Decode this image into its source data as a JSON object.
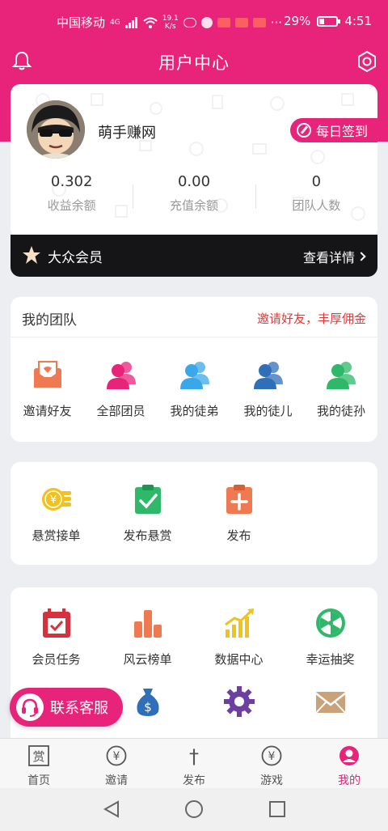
{
  "status_bar": {
    "carrier": "中国移动",
    "network": "4G",
    "speed_value": "19.1",
    "speed_unit": "K/s",
    "battery_percent": "29%",
    "battery_level": 0.29,
    "time": "4:51"
  },
  "header": {
    "title": "用户中心"
  },
  "profile": {
    "username": "萌手赚网",
    "signin_label": "每日签到",
    "stats": [
      {
        "value": "0.302",
        "label": "收益余额"
      },
      {
        "value": "0.00",
        "label": "充值余额"
      },
      {
        "value": "0",
        "label": "团队人数"
      }
    ]
  },
  "membership": {
    "level": "大众会员",
    "detail_label": "查看详情"
  },
  "team": {
    "title": "我的团队",
    "invite_slogan": "邀请好友，丰厚佣金",
    "items": [
      {
        "label": "邀请好友",
        "icon": "invite-mail-icon",
        "color": "#ef7a52"
      },
      {
        "label": "全部团员",
        "icon": "group-icon",
        "color": "#e8237a"
      },
      {
        "label": "我的徒弟",
        "icon": "group-icon",
        "color": "#3aa8e8"
      },
      {
        "label": "我的徒儿",
        "icon": "group-icon",
        "color": "#2f6fb8"
      },
      {
        "label": "我的徒孙",
        "icon": "group-icon",
        "color": "#2fb86a"
      }
    ]
  },
  "tasks": {
    "items": [
      {
        "label": "悬赏接单",
        "icon": "coins-icon",
        "color": "#f2c21a"
      },
      {
        "label": "发布悬赏",
        "icon": "clipboard-check-icon",
        "color": "#2fb86a"
      },
      {
        "label": "发布",
        "icon": "clipboard-plus-icon",
        "color": "#ef7a52"
      }
    ]
  },
  "services": {
    "items": [
      {
        "label": "会员任务",
        "icon": "calendar-check-icon",
        "color": "#d8313e"
      },
      {
        "label": "风云榜单",
        "icon": "bar-chart-icon",
        "color": "#ef7a52"
      },
      {
        "label": "数据中心",
        "icon": "growth-chart-icon",
        "color": "#f2c21a"
      },
      {
        "label": "幸运抽奖",
        "icon": "lucky-wheel-icon",
        "color": "#2fb86a"
      },
      {
        "label": "",
        "icon": "money-bag-icon",
        "color": "#2f6fb8"
      },
      {
        "label": "",
        "icon": "gear-icon",
        "color": "#6c3fa0"
      },
      {
        "label": "",
        "icon": "envelope-icon",
        "color": "#c9a27a"
      }
    ]
  },
  "contact_button": {
    "label": "联系客服"
  },
  "tabbar": {
    "items": [
      {
        "label": "首页",
        "icon": "reward-icon",
        "active": false
      },
      {
        "label": "邀请",
        "icon": "yen-circle-icon",
        "active": false
      },
      {
        "label": "发布",
        "icon": "dagger-icon",
        "active": false
      },
      {
        "label": "游戏",
        "icon": "yen-circle-icon",
        "active": false
      },
      {
        "label": "我的",
        "icon": "user-icon",
        "active": true
      }
    ],
    "reward_glyph": "赏",
    "yen_glyph": "¥",
    "dagger_glyph": "†"
  },
  "colors": {
    "brand": "#e8237a",
    "member_bar": "#151518",
    "invite_red": "#e03a3a"
  }
}
